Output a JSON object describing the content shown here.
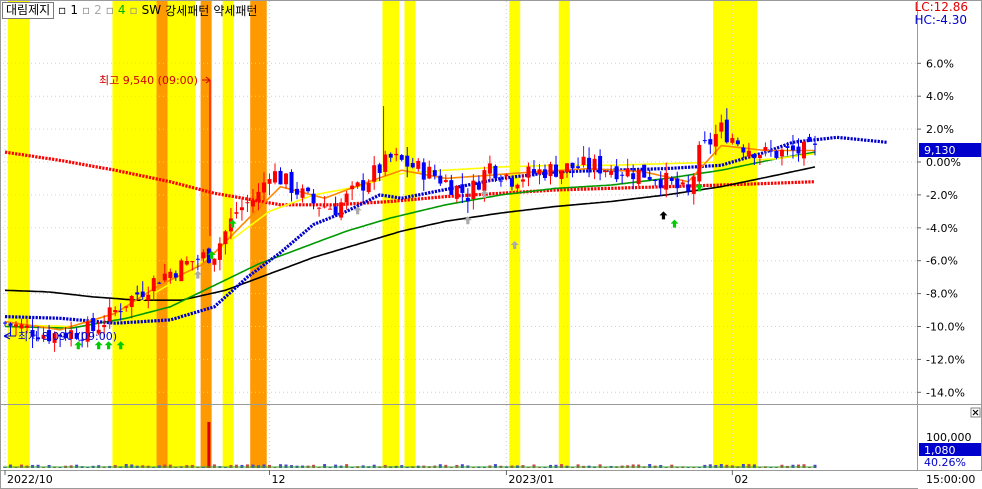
{
  "header": {
    "symbol": "대림제지",
    "check1": "1",
    "check2": "2",
    "check4": "4",
    "sw_label": "SW",
    "pattern_strong": "강세패턴",
    "pattern_weak": "약세패턴",
    "lc": "LC:12.86",
    "hc": "HC:-4.30"
  },
  "annotations": {
    "high": "최고 9,540 (09:00)",
    "low": "최저 8,090 (09:00)"
  },
  "price_badge": "9,130",
  "volume_badge": "1,080",
  "volume_pct": "40.26%",
  "time_label": "15:00:00",
  "colors": {
    "yellow_band": "#ffff00",
    "orange_band": "#ff9900",
    "candle_up": "#ff0000",
    "candle_down": "#0000ff",
    "ma_red": "#ff0000",
    "ma_blue": "#0000cc",
    "ma_yellow": "#ffff00",
    "ma_green": "#009900",
    "ma_black": "#000000",
    "ma_orange": "#ff8800",
    "badge_blue": "#0000cc"
  },
  "chart_data": {
    "type": "line",
    "y_axis": {
      "ticks": [
        "6.0%",
        "4.0%",
        "2.0%",
        "0.00%",
        "-2.0%",
        "-4.0%",
        "-6.0%",
        "-8.0%",
        "-10.0%",
        "-12.0%",
        "-14.0%"
      ],
      "values": [
        6,
        4,
        2,
        0,
        -2,
        -4,
        -6,
        -8,
        -10,
        -12,
        -14
      ],
      "range": [
        -15,
        8
      ]
    },
    "volume_axis": {
      "ticks": [
        "100,000"
      ]
    },
    "x_axis": {
      "ticks": [
        "2022/10",
        "12",
        "2023/01",
        "02"
      ],
      "tick_index": [
        0,
        48,
        91,
        132
      ]
    },
    "n_points": 148,
    "series": [
      {
        "key": "close",
        "points": [
          [
            0,
            -9.8
          ],
          [
            8,
            -10.5
          ],
          [
            16,
            -10.2
          ],
          [
            22,
            -8.5
          ],
          [
            28,
            -7.0
          ],
          [
            34,
            -6.0
          ],
          [
            38,
            -5.5
          ],
          [
            42,
            -3.0
          ],
          [
            46,
            -2.0
          ],
          [
            48,
            -0.5
          ],
          [
            52,
            -1.5
          ],
          [
            56,
            -2.5
          ],
          [
            60,
            -2.8
          ],
          [
            66,
            -1.0
          ],
          [
            70,
            0.2
          ],
          [
            72,
            0.0
          ],
          [
            78,
            -0.8
          ],
          [
            84,
            -2.0
          ],
          [
            88,
            -0.2
          ],
          [
            92,
            -1.0
          ],
          [
            98,
            -0.5
          ],
          [
            106,
            -0.2
          ],
          [
            112,
            -0.5
          ],
          [
            118,
            -0.8
          ],
          [
            124,
            -2.0
          ],
          [
            126,
            0.5
          ],
          [
            130,
            2.0
          ],
          [
            134,
            1.0
          ],
          [
            138,
            0.5
          ],
          [
            142,
            0.6
          ],
          [
            147,
            0.7
          ]
        ]
      },
      {
        "key": "ma_red",
        "points": [
          [
            0,
            0.6
          ],
          [
            10,
            0.1
          ],
          [
            20,
            -0.5
          ],
          [
            30,
            -1.2
          ],
          [
            38,
            -1.9
          ],
          [
            50,
            -2.6
          ],
          [
            60,
            -2.6
          ],
          [
            70,
            -2.4
          ],
          [
            80,
            -2.1
          ],
          [
            90,
            -1.9
          ],
          [
            100,
            -1.7
          ],
          [
            110,
            -1.6
          ],
          [
            120,
            -1.5
          ],
          [
            130,
            -1.4
          ],
          [
            147,
            -1.2
          ]
        ]
      },
      {
        "key": "ma_blue",
        "points": [
          [
            0,
            -9.4
          ],
          [
            10,
            -9.5
          ],
          [
            20,
            -9.8
          ],
          [
            30,
            -9.6
          ],
          [
            38,
            -8.8
          ],
          [
            44,
            -7.0
          ],
          [
            50,
            -5.5
          ],
          [
            56,
            -3.8
          ],
          [
            62,
            -3.0
          ],
          [
            68,
            -2.0
          ],
          [
            72,
            -2.2
          ],
          [
            78,
            -1.8
          ],
          [
            84,
            -1.4
          ],
          [
            90,
            -1.0
          ],
          [
            100,
            -0.6
          ],
          [
            110,
            -0.5
          ],
          [
            120,
            -0.4
          ],
          [
            130,
            -0.2
          ],
          [
            138,
            0.6
          ],
          [
            143,
            1.2
          ],
          [
            151,
            1.5
          ],
          [
            160,
            1.2
          ]
        ]
      },
      {
        "key": "ma_yellow",
        "points": [
          [
            0,
            -9.9
          ],
          [
            12,
            -10.0
          ],
          [
            22,
            -9.0
          ],
          [
            32,
            -7.0
          ],
          [
            40,
            -5.0
          ],
          [
            48,
            -3.0
          ],
          [
            56,
            -2.0
          ],
          [
            64,
            -1.5
          ],
          [
            72,
            -0.7
          ],
          [
            80,
            -0.5
          ],
          [
            90,
            -0.3
          ],
          [
            100,
            -0.2
          ],
          [
            110,
            -0.2
          ],
          [
            120,
            -0.1
          ],
          [
            130,
            0.0
          ],
          [
            140,
            0.2
          ],
          [
            147,
            0.5
          ]
        ]
      },
      {
        "key": "ma_green",
        "points": [
          [
            0,
            -10.0
          ],
          [
            12,
            -10.1
          ],
          [
            22,
            -9.5
          ],
          [
            30,
            -8.8
          ],
          [
            38,
            -7.5
          ],
          [
            46,
            -6.2
          ],
          [
            54,
            -5.2
          ],
          [
            62,
            -4.2
          ],
          [
            70,
            -3.4
          ],
          [
            80,
            -2.6
          ],
          [
            90,
            -2.0
          ],
          [
            100,
            -1.6
          ],
          [
            110,
            -1.4
          ],
          [
            120,
            -1.0
          ],
          [
            130,
            -0.5
          ],
          [
            140,
            0.2
          ],
          [
            147,
            0.6
          ]
        ]
      },
      {
        "key": "ma_black",
        "points": [
          [
            0,
            -7.8
          ],
          [
            8,
            -7.9
          ],
          [
            16,
            -8.2
          ],
          [
            24,
            -8.4
          ],
          [
            32,
            -8.4
          ],
          [
            40,
            -7.8
          ],
          [
            48,
            -6.8
          ],
          [
            56,
            -5.8
          ],
          [
            64,
            -5.0
          ],
          [
            72,
            -4.2
          ],
          [
            80,
            -3.6
          ],
          [
            90,
            -3.1
          ],
          [
            100,
            -2.7
          ],
          [
            110,
            -2.4
          ],
          [
            120,
            -2.0
          ],
          [
            130,
            -1.5
          ],
          [
            140,
            -0.8
          ],
          [
            147,
            -0.3
          ]
        ]
      },
      {
        "key": "ma_orange",
        "points": [
          [
            0,
            -9.7
          ],
          [
            10,
            -10.2
          ],
          [
            20,
            -9.2
          ],
          [
            28,
            -7.5
          ],
          [
            36,
            -6.2
          ],
          [
            44,
            -3.5
          ],
          [
            50,
            -1.5
          ],
          [
            58,
            -2.2
          ],
          [
            66,
            -1.2
          ],
          [
            72,
            -0.5
          ],
          [
            80,
            -1.0
          ],
          [
            88,
            -0.8
          ],
          [
            96,
            -0.6
          ],
          [
            106,
            -0.4
          ],
          [
            116,
            -0.6
          ],
          [
            124,
            -1.2
          ],
          [
            130,
            1.0
          ],
          [
            138,
            0.7
          ],
          [
            147,
            0.7
          ]
        ]
      }
    ],
    "bands_yellow": [
      [
        1,
        4
      ],
      [
        20,
        27
      ],
      [
        30,
        34
      ],
      [
        40,
        41
      ],
      [
        69,
        71
      ],
      [
        73,
        74
      ],
      [
        92,
        93
      ],
      [
        101,
        102
      ],
      [
        129,
        136
      ]
    ],
    "bands_orange": [
      [
        28,
        29
      ],
      [
        36,
        37
      ],
      [
        45,
        47
      ]
    ]
  }
}
